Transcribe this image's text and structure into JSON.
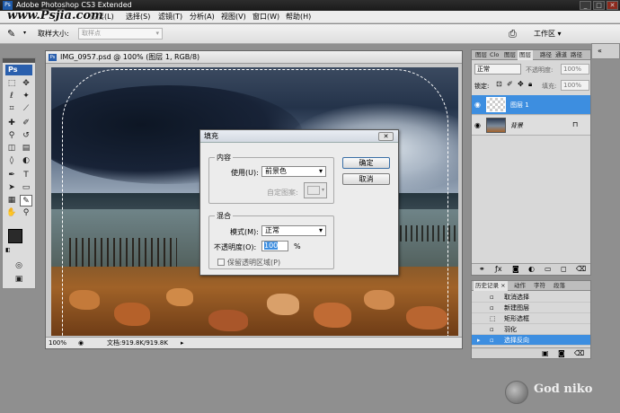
{
  "app": {
    "title": "Adobe Photoshop CS3 Extended",
    "icon_text": "Ps",
    "window_buttons": [
      "_",
      "□",
      "✕"
    ]
  },
  "watermark_top": "www.Psjia.com",
  "menu": [
    "文件(F)",
    "编辑(E)",
    "图像(I)",
    "图层(L)",
    "选择(S)",
    "滤镜(T)",
    "分析(A)",
    "视图(V)",
    "窗口(W)",
    "帮助(H)"
  ],
  "options_bar": {
    "sample_size_label": "取样大小:",
    "sample_size_value": "取样点",
    "workspace_label": "工作区 ▾"
  },
  "toolbox": {
    "logo": "Ps"
  },
  "document": {
    "icon_text": "Ps",
    "title": "IMG_0957.psd @ 100% (图层 1, RGB/8)",
    "zoom": "100%",
    "doc_size": "文档:919.8K/919.8K"
  },
  "layers_panel": {
    "tabs": [
      "图层",
      "Clo",
      "图层",
      "图层",
      "路径",
      "通道",
      "路径"
    ],
    "blend_mode": "正常",
    "opacity_label": "不透明度:",
    "opacity_value": "100%",
    "lock_label": "锁定:",
    "fill_label": "填充:",
    "fill_value": "100%",
    "layers": [
      {
        "name": "图层 1",
        "selected": true
      },
      {
        "name": "背景",
        "selected": false
      }
    ]
  },
  "history_panel": {
    "tabs": [
      "历史记录 ×",
      "动作",
      "字符",
      "段落"
    ],
    "items": [
      {
        "label": "取消选择",
        "selected": false
      },
      {
        "label": "新建图层",
        "selected": false
      },
      {
        "label": "矩形选框",
        "selected": false
      },
      {
        "label": "羽化",
        "selected": false
      },
      {
        "label": "选择反向",
        "selected": true
      }
    ]
  },
  "fill_dialog": {
    "title": "填充",
    "close": "✕",
    "content_group": "内容",
    "use_label": "使用(U):",
    "use_value": "前景色",
    "custom_pattern_label": "自定图案:",
    "blending_group": "混合",
    "mode_label": "模式(M):",
    "mode_value": "正常",
    "opacity_label": "不透明度(O):",
    "opacity_value": "100",
    "percent": "%",
    "preserve_label": "保留透明区域(P)",
    "ok": "确定",
    "cancel": "取消"
  },
  "footer_logo": "God niko",
  "colors": {
    "selection": "#3d8ee0",
    "ps_blue": "#2a5fad"
  }
}
